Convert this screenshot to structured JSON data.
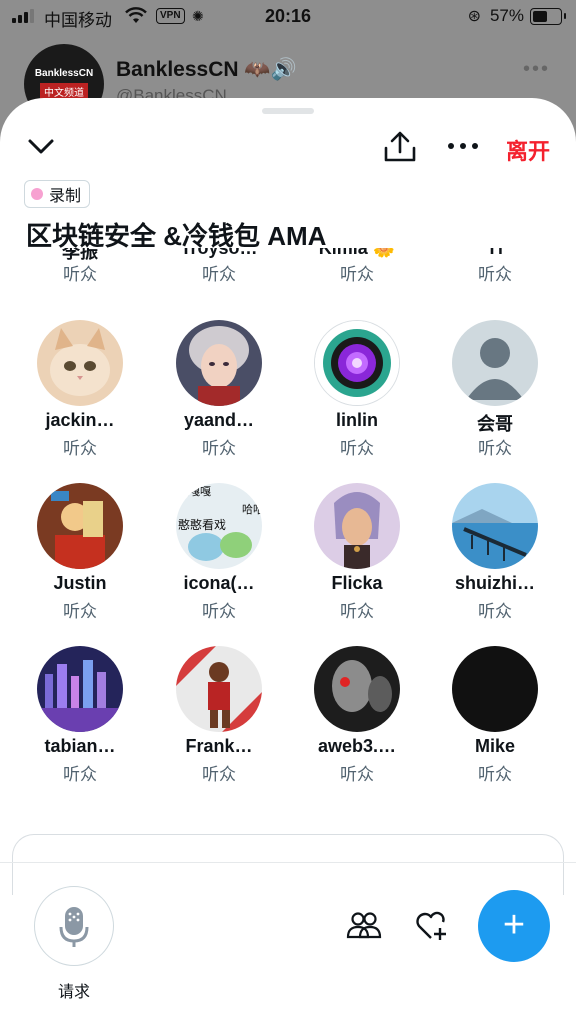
{
  "status": {
    "carrier": "中国移动",
    "vpn": "VPN",
    "time": "20:16",
    "battery": "57%",
    "battery_level": 0.57
  },
  "background": {
    "avatar_line1": "BanklessCN",
    "avatar_line2": "中文频道",
    "host_name": "BanklessCN 🦇🔊",
    "host_handle": "@BanklessCN"
  },
  "space": {
    "leave_label": "离开",
    "recording_label": "录制",
    "title": "区块链安全 &冷钱包 AMA",
    "request_label": "请求"
  },
  "partial_row": [
    {
      "name": "李振",
      "role": "听众"
    },
    {
      "name": "Troyso…",
      "role": "听众"
    },
    {
      "name": "Kimia 🌼",
      "role": "听众"
    },
    {
      "name": "Tf",
      "role": "听众"
    }
  ],
  "listeners": [
    {
      "name": "jackin…",
      "role": "听众",
      "avatar": "kitten",
      "color": "#e7c9a9"
    },
    {
      "name": "yaand…",
      "role": "听众",
      "avatar": "anime-girl",
      "color": "#6b6f86"
    },
    {
      "name": "linlin",
      "role": "听众",
      "avatar": "purple-orb",
      "color": "#2ba58f"
    },
    {
      "name": "会哥",
      "role": "听众",
      "avatar": "default-person",
      "color": "#cfd9de"
    },
    {
      "name": "Justin",
      "role": "听众",
      "avatar": "figurine",
      "color": "#b8552d"
    },
    {
      "name": "icona(…",
      "role": "听众",
      "avatar": "sticker",
      "color": "#d9e6ee"
    },
    {
      "name": "Flicka",
      "role": "听众",
      "avatar": "illustrated-woman",
      "color": "#d7c3e1"
    },
    {
      "name": "shuizhi…",
      "role": "听众",
      "avatar": "lake-pier",
      "color": "#5fa8d8"
    },
    {
      "name": "tabian…",
      "role": "听众",
      "avatar": "city-night",
      "color": "#3b2c7a"
    },
    {
      "name": "Frank…",
      "role": "听众",
      "avatar": "basketball",
      "color": "#d53c3c"
    },
    {
      "name": "aweb3.…",
      "role": "听众",
      "avatar": "dark-face",
      "color": "#2a2a2a"
    },
    {
      "name": "Mike",
      "role": "听众",
      "avatar": "black",
      "color": "#111111"
    }
  ],
  "sticker_texts": [
    "嘎嘎嘎",
    "憨憨看戏",
    "哈哈"
  ]
}
